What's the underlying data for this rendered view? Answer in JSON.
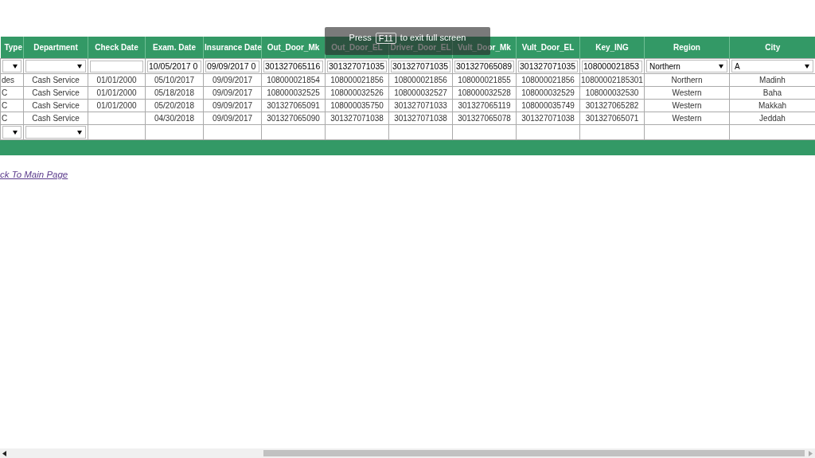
{
  "fullscreen_notice": {
    "before": "Press",
    "key": "F11",
    "after": "to exit full screen"
  },
  "table": {
    "columns": [
      "Type",
      "Department",
      "Check Date",
      "Exam. Date",
      "Insurance Date",
      "Out_Door_Mk",
      "Out_Door_EL",
      "Driver_Door_EL",
      "Vult_Door_Mk",
      "Vult_Door_EL",
      "Key_ING",
      "Region",
      "City"
    ],
    "filter_row": [
      {
        "kind": "select"
      },
      {
        "kind": "select"
      },
      {
        "kind": "input"
      },
      {
        "kind": "input",
        "value": "10/05/2017 0"
      },
      {
        "kind": "input",
        "value": "09/09/2017 0"
      },
      {
        "kind": "input",
        "value": "301327065116"
      },
      {
        "kind": "input",
        "value": "301327071035"
      },
      {
        "kind": "input",
        "value": "301327071035"
      },
      {
        "kind": "input",
        "value": "301327065089"
      },
      {
        "kind": "input",
        "value": "301327071035"
      },
      {
        "kind": "input",
        "value": "108000021853"
      },
      {
        "kind": "select",
        "value": "Northern"
      },
      {
        "kind": "select",
        "value": "A"
      }
    ],
    "rows": [
      [
        "des",
        "Cash Service",
        "01/01/2000",
        "05/10/2017",
        "09/09/2017",
        "108000021854",
        "108000021856",
        "108000021856",
        "108000021855",
        "108000021856",
        "10800002185301",
        "Northern",
        "Madinh"
      ],
      [
        "C",
        "Cash Service",
        "01/01/2000",
        "05/18/2018",
        "09/09/2017",
        "108000032525",
        "108000032526",
        "108000032527",
        "108000032528",
        "108000032529",
        "108000032530",
        "Western",
        "Baha"
      ],
      [
        "C",
        "Cash Service",
        "01/01/2000",
        "05/20/2018",
        "09/09/2017",
        "301327065091",
        "108000035750",
        "301327071033",
        "301327065119",
        "108000035749",
        "301327065282",
        "Western",
        "Makkah"
      ],
      [
        "C",
        "Cash Service",
        "",
        "04/30/2018",
        "09/09/2017",
        "301327065090",
        "301327071038",
        "301327071038",
        "301327065078",
        "301327071038",
        "301327065071",
        "Western",
        "Jeddah"
      ]
    ],
    "footer_row": [
      {
        "kind": "select"
      },
      {
        "kind": "select"
      },
      {
        "kind": "empty"
      },
      {
        "kind": "empty"
      },
      {
        "kind": "empty"
      },
      {
        "kind": "empty"
      },
      {
        "kind": "empty"
      },
      {
        "kind": "empty"
      },
      {
        "kind": "empty"
      },
      {
        "kind": "empty"
      },
      {
        "kind": "empty"
      },
      {
        "kind": "empty"
      },
      {
        "kind": "empty"
      }
    ]
  },
  "link": "ck To Main Page"
}
